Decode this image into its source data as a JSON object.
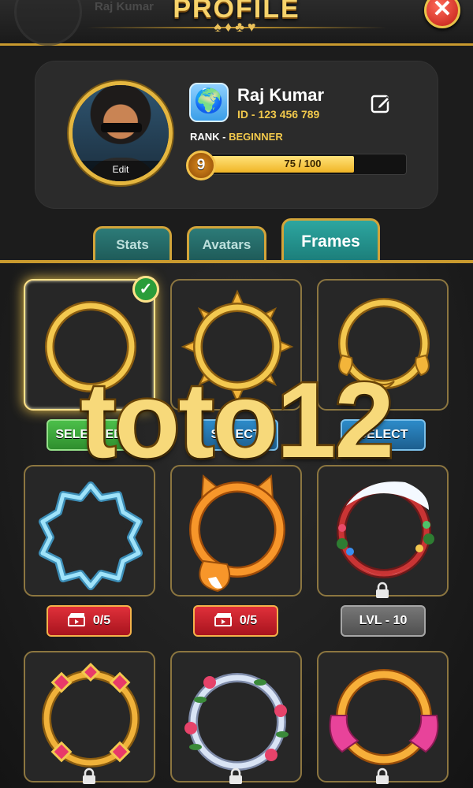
{
  "header": {
    "title": "PROFILE",
    "suits": "♠♦♣♥",
    "ghost_name": "Raj Kumar",
    "close_label": "✕"
  },
  "profile": {
    "name": "Raj Kumar",
    "id": "ID - 123 456 789",
    "rank_label": "RANK -",
    "rank_value": "BEGINNER",
    "level": "9",
    "xp_text": "75 / 100",
    "xp_fraction": 0.75,
    "avatar_edit": "Edit",
    "globe_icon": "🌍"
  },
  "tabs": [
    {
      "label": "Stats",
      "active": false
    },
    {
      "label": "Avatars",
      "active": false
    },
    {
      "label": "Frames",
      "active": true
    }
  ],
  "frames": {
    "row1_buttons": [
      "SELECTED",
      "SELECT",
      "SELECT"
    ],
    "row2_buttons": [
      "0/5",
      "0/5",
      "LVL - 10"
    ],
    "colors": {
      "gold": "#f0c24a",
      "ice": "#7fd3f0",
      "fox": "#f08a2a",
      "holiday": "#d43a3a",
      "jewel": "#e89a2a",
      "floral": "#c7d7ee",
      "ribbon": "#e8439a"
    }
  },
  "watermark": "toto12"
}
